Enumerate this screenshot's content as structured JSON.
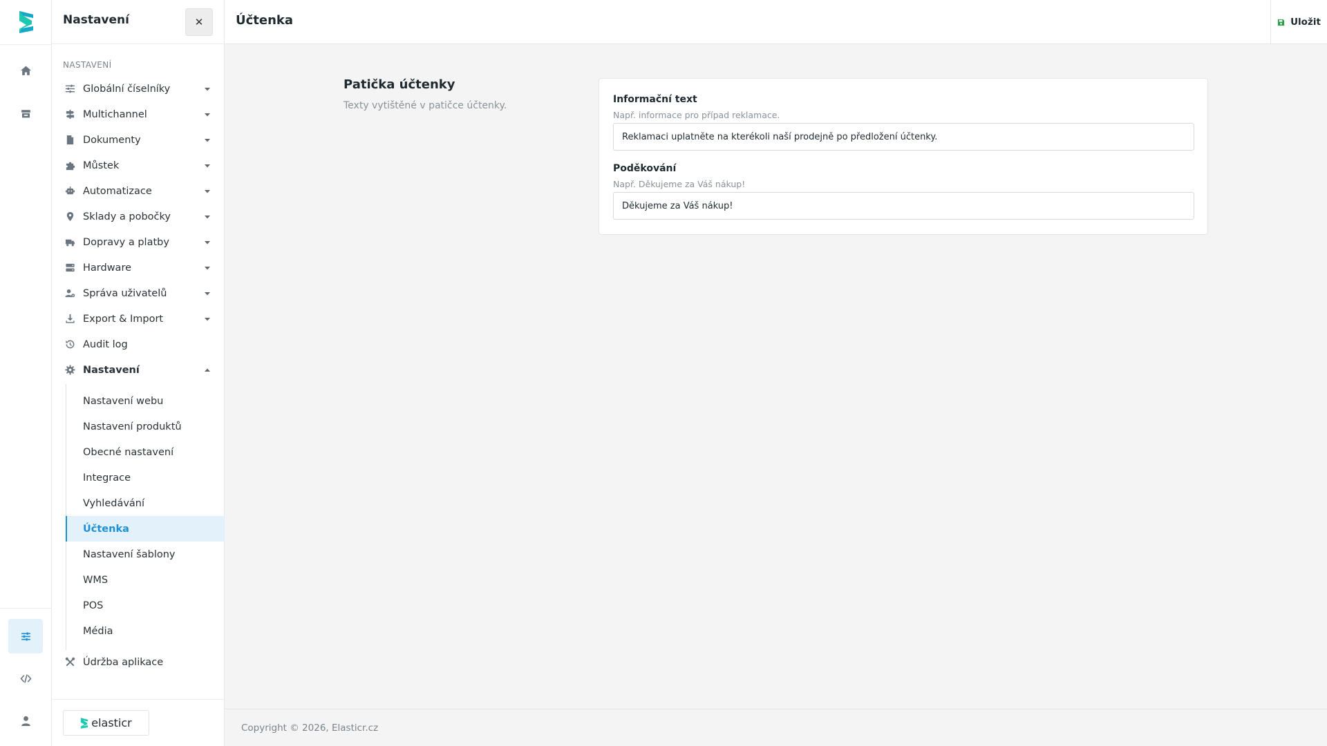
{
  "sidebar": {
    "title": "Nastavení",
    "section_label": "NASTAVENÍ",
    "items": [
      {
        "label": "Globální číselníky",
        "icon": "sliders-icon"
      },
      {
        "label": "Multichannel",
        "icon": "signpost-icon"
      },
      {
        "label": "Dokumenty",
        "icon": "document-icon"
      },
      {
        "label": "Můstek",
        "icon": "puzzle-icon"
      },
      {
        "label": "Automatizace",
        "icon": "robot-icon"
      },
      {
        "label": "Sklady a pobočky",
        "icon": "map-pin-icon"
      },
      {
        "label": "Dopravy a platby",
        "icon": "truck-icon"
      },
      {
        "label": "Hardware",
        "icon": "server-icon"
      },
      {
        "label": "Správa uživatelů",
        "icon": "users-cog-icon"
      },
      {
        "label": "Export & Import",
        "icon": "download-icon"
      },
      {
        "label": "Audit log",
        "icon": "history-icon"
      },
      {
        "label": "Nastavení",
        "icon": "gear-icon"
      }
    ],
    "subitems": [
      {
        "label": "Nastavení webu"
      },
      {
        "label": "Nastavení produktů"
      },
      {
        "label": "Obecné nastavení"
      },
      {
        "label": "Integrace"
      },
      {
        "label": "Vyhledávání"
      },
      {
        "label": "Účtenka"
      },
      {
        "label": "Nastavení šablony"
      },
      {
        "label": "WMS"
      },
      {
        "label": "POS"
      },
      {
        "label": "Média"
      }
    ],
    "maintenance": {
      "label": "Údržba aplikace",
      "icon": "tools-icon"
    },
    "brand": "elasticr"
  },
  "header": {
    "title": "Účtenka",
    "save_label": "Uložit"
  },
  "section": {
    "title": "Patička účtenky",
    "description": "Texty vytištěné v patičce účtenky."
  },
  "fields": {
    "info": {
      "label": "Informační text",
      "hint": "Např. informace pro případ reklamace.",
      "value": "Reklamaci uplatněte na kterékoli naší prodejně po předložení účtenky."
    },
    "thanks": {
      "label": "Poděkování",
      "hint": "Např. Děkujeme za Váš nákup!",
      "value": "Děkujeme za Váš nákup!"
    }
  },
  "footer": {
    "copyright": "Copyright © 2026, Elasticr.cz"
  },
  "colors": {
    "accent": "#1d8fd6",
    "brand_teal": "#1ec8b0",
    "save_icon": "#2e9d4a"
  }
}
